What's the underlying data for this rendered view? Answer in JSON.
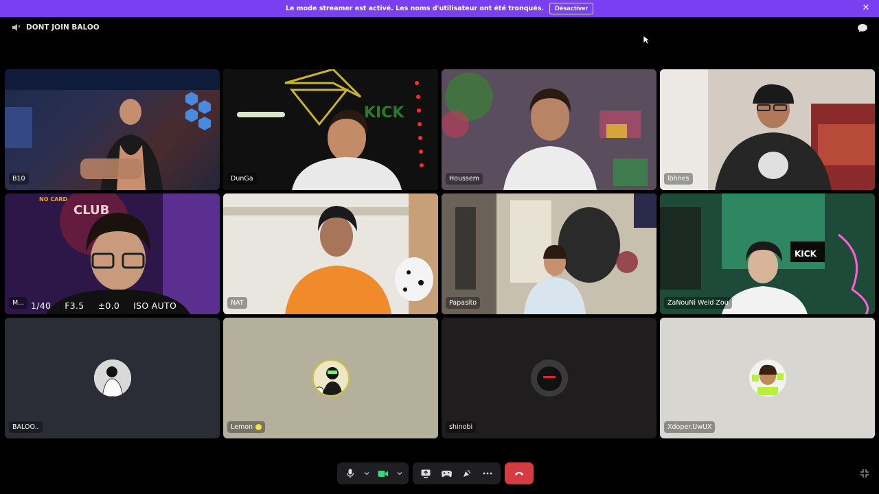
{
  "banner": {
    "message": "Le mode streamer est activé. Les noms d'utilisateur ont été tronqués.",
    "deactivate_label": "Désactiver",
    "close_symbol": "✕"
  },
  "header": {
    "channel_name": "DONT JOIN BALOO",
    "channel_icon": "speaker-icon"
  },
  "participants": [
    {
      "name": "B10",
      "type": "video",
      "speaking": false
    },
    {
      "name": "DunGa",
      "type": "video",
      "speaking": true
    },
    {
      "name": "Houssem",
      "type": "video",
      "speaking": false
    },
    {
      "name": "lbhnes",
      "type": "video",
      "speaking": false
    },
    {
      "name": "M...",
      "type": "video",
      "speaking": false,
      "overlay": {
        "shutter": "1/40",
        "aperture": "F3.5",
        "exposure": "±0.0",
        "iso": "ISO AUTO",
        "tag": "NO CARD"
      }
    },
    {
      "name": "NAT",
      "type": "video",
      "speaking": false
    },
    {
      "name": "Papasito",
      "type": "video",
      "speaking": false
    },
    {
      "name": "ZaNouNi Weld Zou",
      "type": "video",
      "speaking": false
    },
    {
      "name": "BALOO..",
      "type": "avatar",
      "background": "#2b2d36"
    },
    {
      "name": "Lemon",
      "type": "avatar",
      "background": "#b5b09c"
    },
    {
      "name": "shinobi",
      "type": "avatar",
      "background": "#1f1d1d"
    },
    {
      "name": "Xdoper.UwUX",
      "type": "avatar",
      "background": "#d8d6d1"
    }
  ],
  "controls": {
    "items": [
      "microphone-icon",
      "mic-options-chevron",
      "camera-icon",
      "camera-options-chevron",
      "screen-share-icon",
      "activity-icon",
      "soundboard-icon",
      "more-icon",
      "hangup-icon"
    ]
  },
  "colors": {
    "banner": "#7b3ff2",
    "speaking_border": "#3fd47a",
    "hangup": "#d83a42",
    "camera_active": "#3fd47a"
  }
}
